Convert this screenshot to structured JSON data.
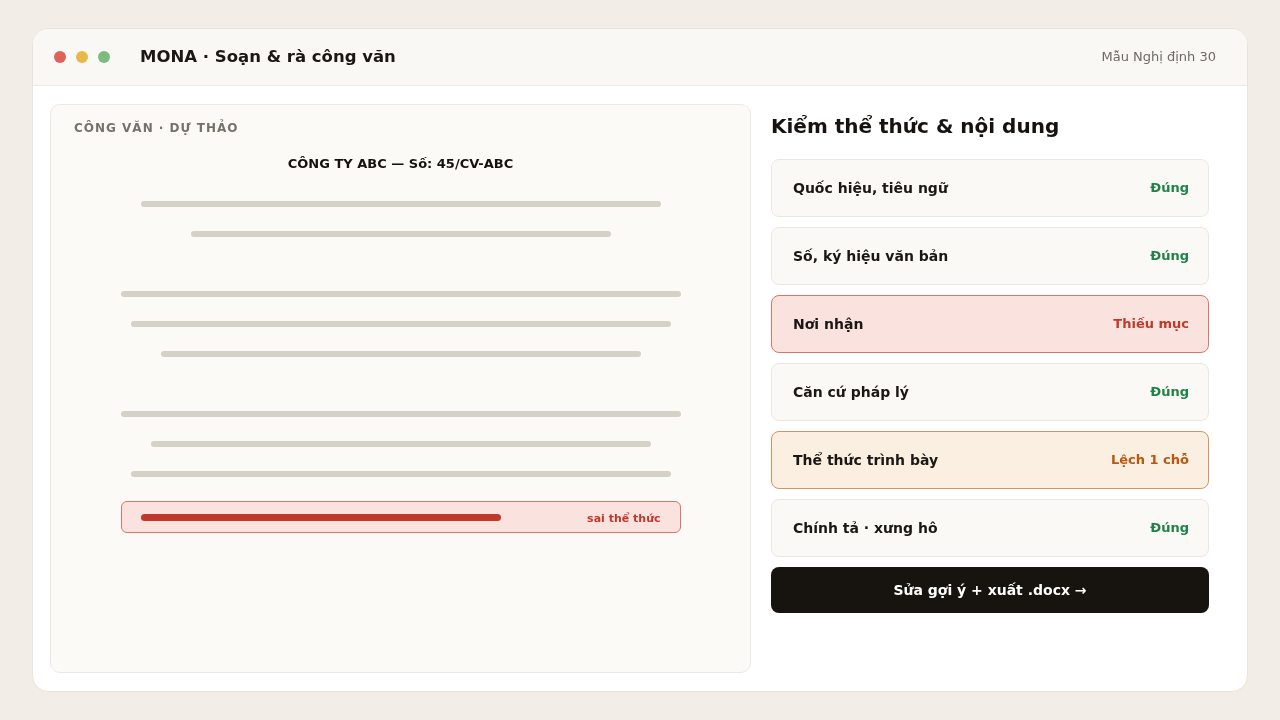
{
  "window": {
    "title": "MONA · Soạn & rà công văn",
    "template": "Mẫu Nghị định 30"
  },
  "draft": {
    "label": "CÔNG VĂN · DỰ THẢO",
    "heading": "CÔNG TY ABC — Số: 45/CV-ABC",
    "flag": "sai thể thức"
  },
  "checks": {
    "title": "Kiểm thể thức & nội dung",
    "items": [
      {
        "label": "Quốc hiệu, tiêu ngữ",
        "result": "Đúng",
        "kind": "ok"
      },
      {
        "label": "Số, ký hiệu văn bản",
        "result": "Đúng",
        "kind": "ok"
      },
      {
        "label": "Nơi nhận",
        "result": "Thiếu mục",
        "kind": "error"
      },
      {
        "label": "Căn cứ pháp lý",
        "result": "Đúng",
        "kind": "ok"
      },
      {
        "label": "Thể thức trình bày",
        "result": "Lệch 1 chỗ",
        "kind": "warning"
      },
      {
        "label": "Chính tả · xưng hô",
        "result": "Đúng",
        "kind": "ok"
      }
    ]
  },
  "action_button": "Sửa gợi ý + xuất .docx →"
}
